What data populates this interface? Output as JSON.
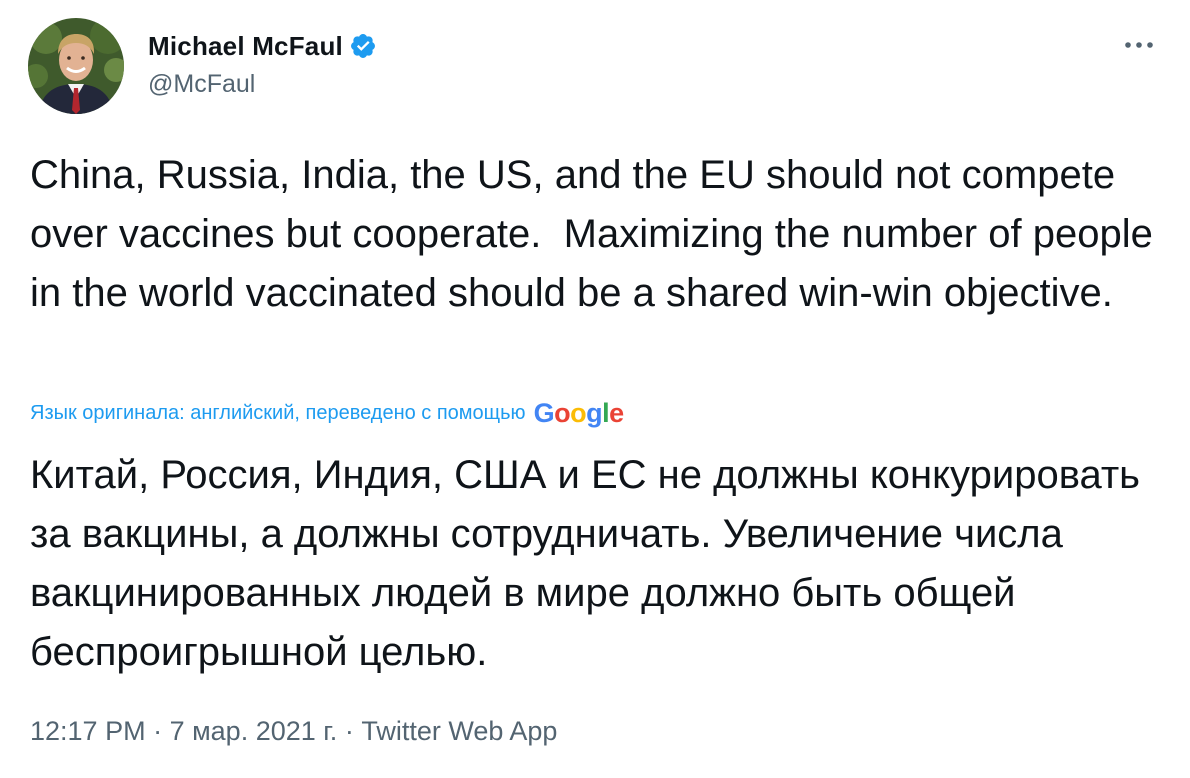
{
  "author": {
    "display_name": "Michael McFaul",
    "handle": "@McFaul",
    "verified_icon": "verified-badge-icon",
    "verified_color": "#1d9bf0"
  },
  "tweet": {
    "text_original": "China, Russia, India, the US, and the EU should not compete over vaccines but cooperate.  Maximizing the number of people in the world vaccinated should be a shared win-win objective.",
    "translation_notice": "Язык оригинала: английский, переведено с помощью",
    "translation_provider": "Google",
    "text_translated": "Китай, Россия, Индия, США и ЕС не должны конкурировать за вакцины, а должны сотрудничать. Увеличение числа вакцинированных людей в мире должно быть общей беспроигрышной целью."
  },
  "meta": {
    "time": "12:17 PM",
    "separator": " · ",
    "date": "7 мар. 2021 г.",
    "source": "Twitter Web App"
  },
  "colors": {
    "text": "#0f1419",
    "secondary": "#536471",
    "accent": "#1d9bf0"
  },
  "icons": {
    "more": "more-horizontal-icon"
  }
}
